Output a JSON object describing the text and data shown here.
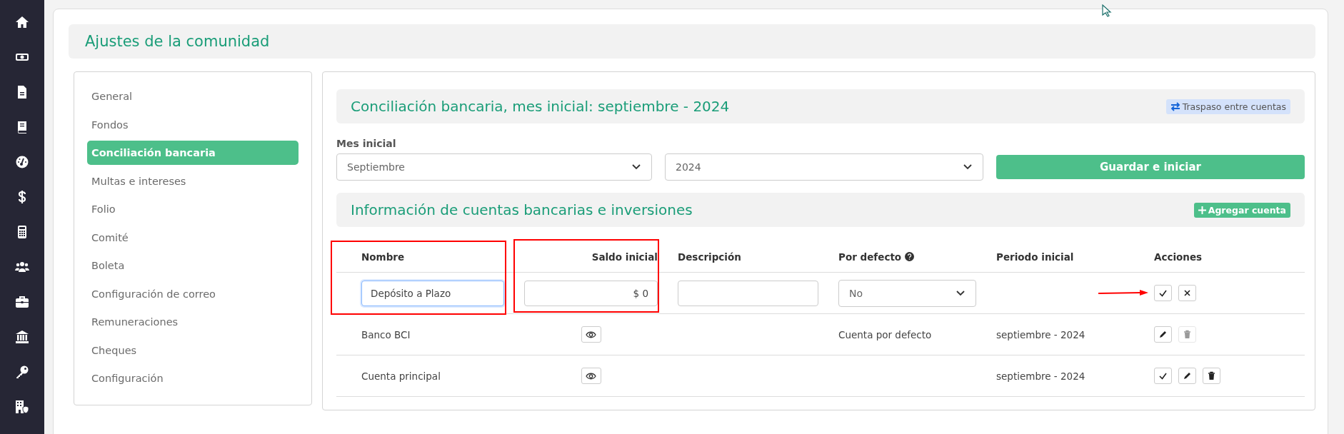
{
  "page_title": "Ajustes de la comunidad",
  "menu": [
    {
      "label": "General",
      "selected": false
    },
    {
      "label": "Fondos",
      "selected": false
    },
    {
      "label": "Conciliación bancaria",
      "selected": true
    },
    {
      "label": "Multas e intereses",
      "selected": false
    },
    {
      "label": "Folio",
      "selected": false
    },
    {
      "label": "Comité",
      "selected": false
    },
    {
      "label": "Boleta",
      "selected": false
    },
    {
      "label": "Configuración de correo",
      "selected": false
    },
    {
      "label": "Remuneraciones",
      "selected": false
    },
    {
      "label": "Cheques",
      "selected": false
    },
    {
      "label": "Configuración",
      "selected": false
    }
  ],
  "bank_section": {
    "title": "Conciliación bancaria, mes inicial: septiembre - 2024",
    "transfer_button": "Traspaso entre cuentas",
    "start_label": "Mes inicial",
    "month_select": {
      "value": "Septiembre"
    },
    "year_select": {
      "value": "2024"
    },
    "save_button": "Guardar e iniciar"
  },
  "accounts_section": {
    "title": "Información de cuentas bancarias e inversiones",
    "add_button": "Agregar cuenta",
    "table": {
      "columns": [
        {
          "label": "Nombre"
        },
        {
          "label": "Saldo inicial"
        },
        {
          "label": "Descripción"
        },
        {
          "label": "Por defecto",
          "help": true
        },
        {
          "label": "Periodo inicial"
        },
        {
          "label": "Acciones"
        }
      ],
      "new_row": {
        "name": "Depósito a Plazo",
        "name_focused": true,
        "balance": "$ 0",
        "default_select": "No",
        "actions": [
          {
            "kind": "confirm",
            "disabled": false
          },
          {
            "kind": "cancel",
            "disabled": false
          }
        ]
      },
      "rows": [
        {
          "name": "Banco BCI",
          "default_label": "Cuenta por defecto",
          "period": "septiembre - 2024",
          "actions": [
            {
              "kind": "edit",
              "disabled": false
            },
            {
              "kind": "delete",
              "disabled": true
            }
          ]
        },
        {
          "name": "Cuenta principal",
          "period": "septiembre - 2024",
          "actions": [
            {
              "kind": "confirm",
              "disabled": false
            },
            {
              "kind": "edit",
              "disabled": false
            },
            {
              "kind": "delete",
              "disabled": false
            }
          ]
        }
      ]
    }
  }
}
